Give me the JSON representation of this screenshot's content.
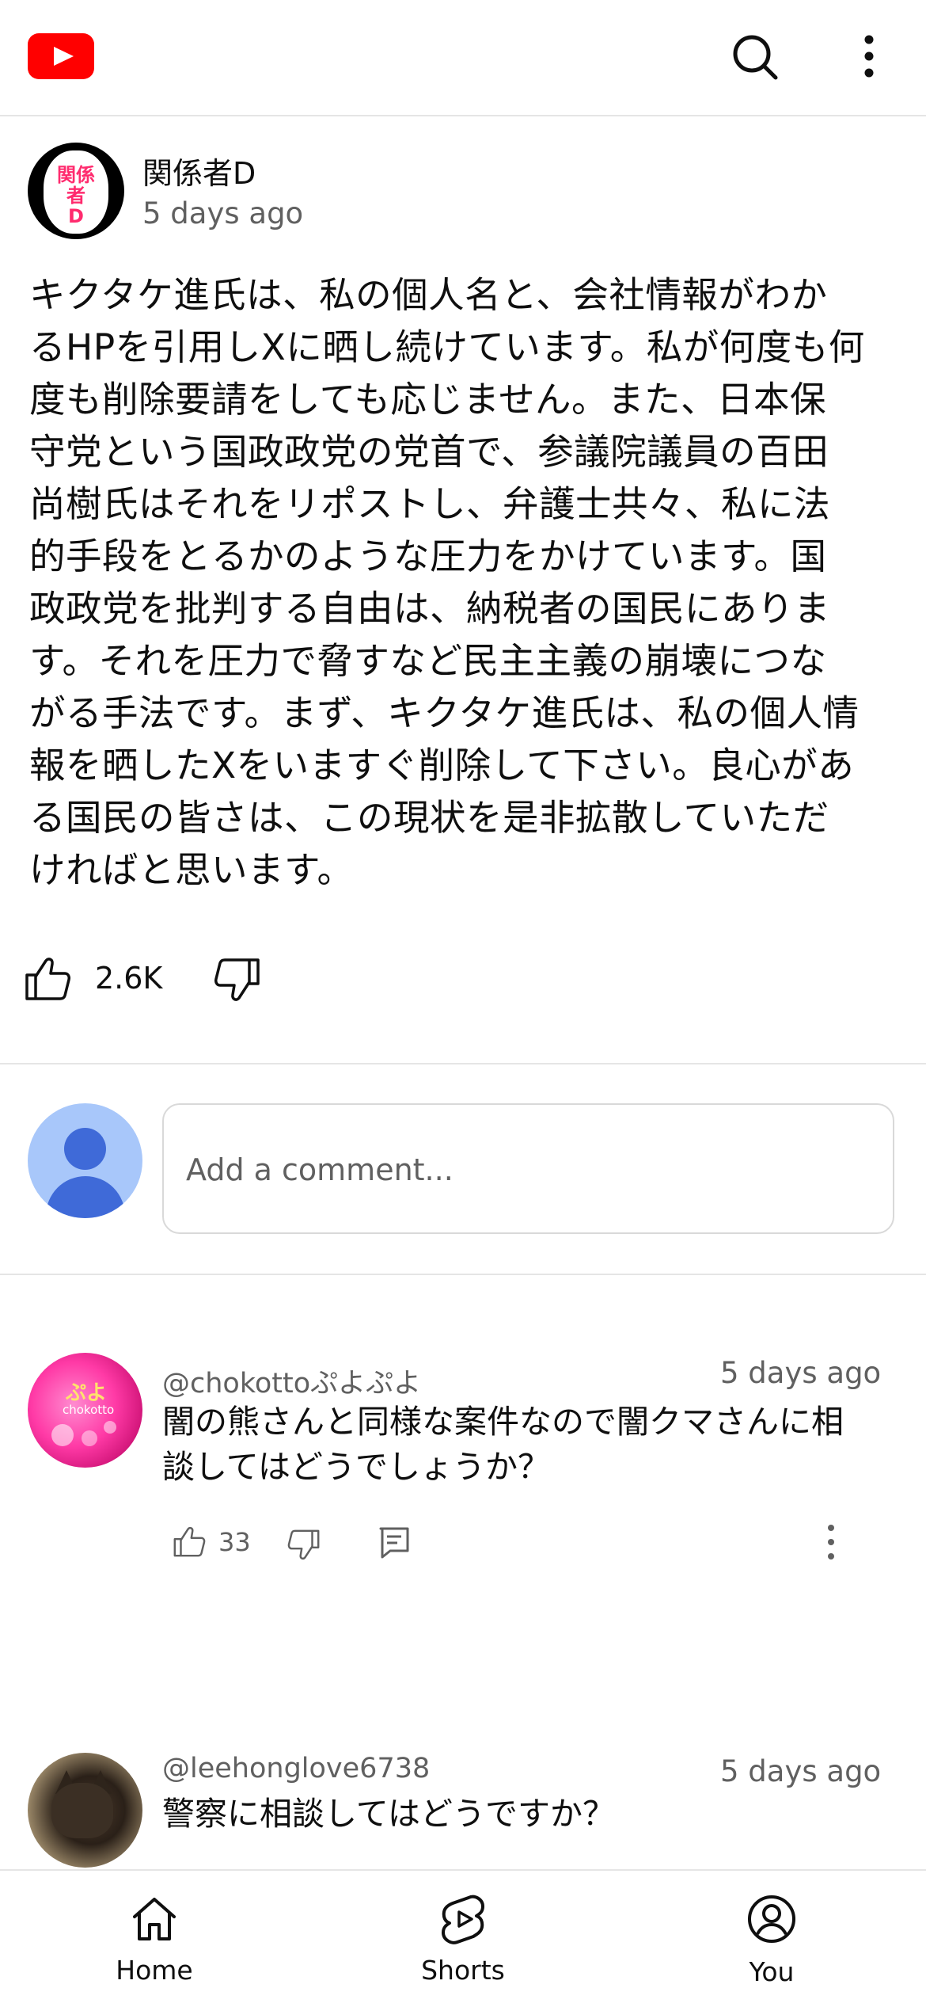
{
  "header": {
    "logo": "youtube-logo",
    "icons": [
      "search-icon",
      "more-vert-icon"
    ]
  },
  "post": {
    "author": "関係者D",
    "time": "5 days ago",
    "lines": [
      "キクタケ進氏は、私の個人名と、会社情報がわか",
      "るHPを引用しXに晒し続けています。私が何度も何",
      "度も削除要請をしても応じません。また、日本保",
      "守党という国政政党の党首で、参議院議員の百田",
      "尚樹氏はそれをリポストし、弁護士共々、私に法",
      "的手段をとるかのような圧力をかけています。国",
      "政政党を批判する自由は、納税者の国民にありま",
      "す。それを圧力で脅すなど民主主義の崩壊につな",
      "がる手法です。まず、キクタケ進氏は、私の個人情",
      "報を晒したXをいますぐ削除して下さい。良心があ",
      "る国民の皆さは、この現状を是非拡散していただ",
      "ければと思います。"
    ],
    "likes": "2.6K"
  },
  "comment_input": {
    "placeholder": "Add a comment..."
  },
  "comments": [
    {
      "handle": "@chokottoぷよぷよ",
      "time": "5 days ago",
      "lines": [
        "闇の熊さんと同様な案件なので闇クマさんに相",
        "談してはどうでしょうか？"
      ],
      "likes": "33",
      "avatar_text": "ぷよ",
      "avatar_sub": "chokotto"
    },
    {
      "handle": "@leehonglove6738",
      "time": "5 days ago",
      "lines": [
        "警察に相談してはどうですか？"
      ]
    }
  ],
  "bottom_nav": [
    {
      "label": "Home",
      "icon": "home-icon"
    },
    {
      "label": "Shorts",
      "icon": "shorts-icon"
    },
    {
      "label": "You",
      "icon": "account-circle-icon"
    }
  ],
  "colors": {
    "brand": "#ff0000",
    "text": "#0f0f0f",
    "secondary_text": "#606060",
    "divider": "#e5e5e5"
  }
}
